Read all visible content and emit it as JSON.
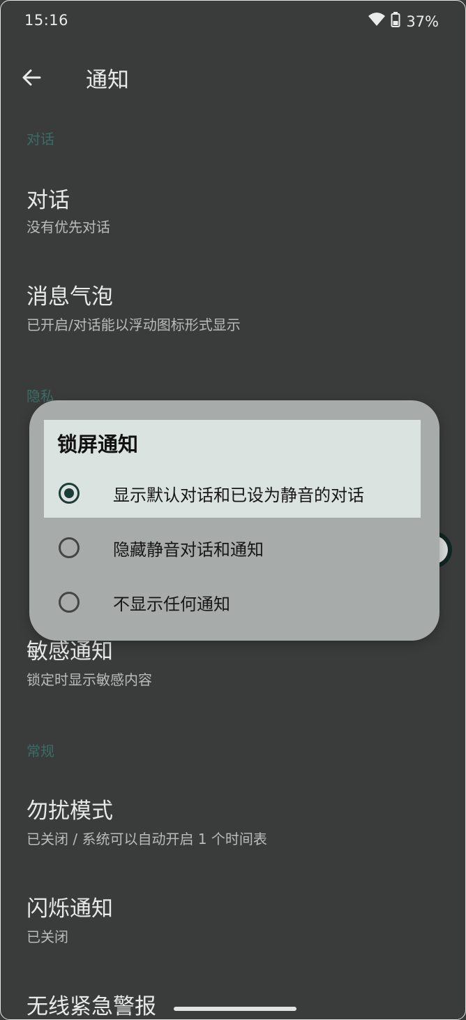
{
  "status_bar": {
    "time": "15:16",
    "battery_percent": "37%",
    "icons": [
      "wifi-icon",
      "battery-icon"
    ]
  },
  "app_bar": {
    "title": "通知",
    "back_icon": "arrow-back-icon"
  },
  "sections": {
    "conversations_header": "对话",
    "privacy_header": "隐私",
    "general_header": "常规"
  },
  "items": {
    "conversations": {
      "title": "对话",
      "subtitle": "没有优先对话"
    },
    "bubbles": {
      "title": "消息气泡",
      "subtitle": "已开启/对话能以浮动图标形式显示"
    },
    "sensitive": {
      "title": "敏感通知",
      "subtitle": "锁定时显示敏感内容",
      "toggle_on": true
    },
    "dnd": {
      "title": "勿扰模式",
      "subtitle": "已关闭 / 系统可以自动开启 1 个时间表"
    },
    "flash": {
      "title": "闪烁通知",
      "subtitle": "已关闭"
    },
    "emergency": {
      "title": "无线紧急警报"
    }
  },
  "dialog": {
    "title": "锁屏通知",
    "options": [
      {
        "label": "显示默认对话和已设为静音的对话",
        "selected": true
      },
      {
        "label": "隐藏静音对话和通知",
        "selected": false
      },
      {
        "label": "不显示任何通知",
        "selected": false
      }
    ]
  },
  "colors": {
    "background": "#3c3e3d",
    "accent": "#1e3c37",
    "dialog": "#a7acaa"
  }
}
